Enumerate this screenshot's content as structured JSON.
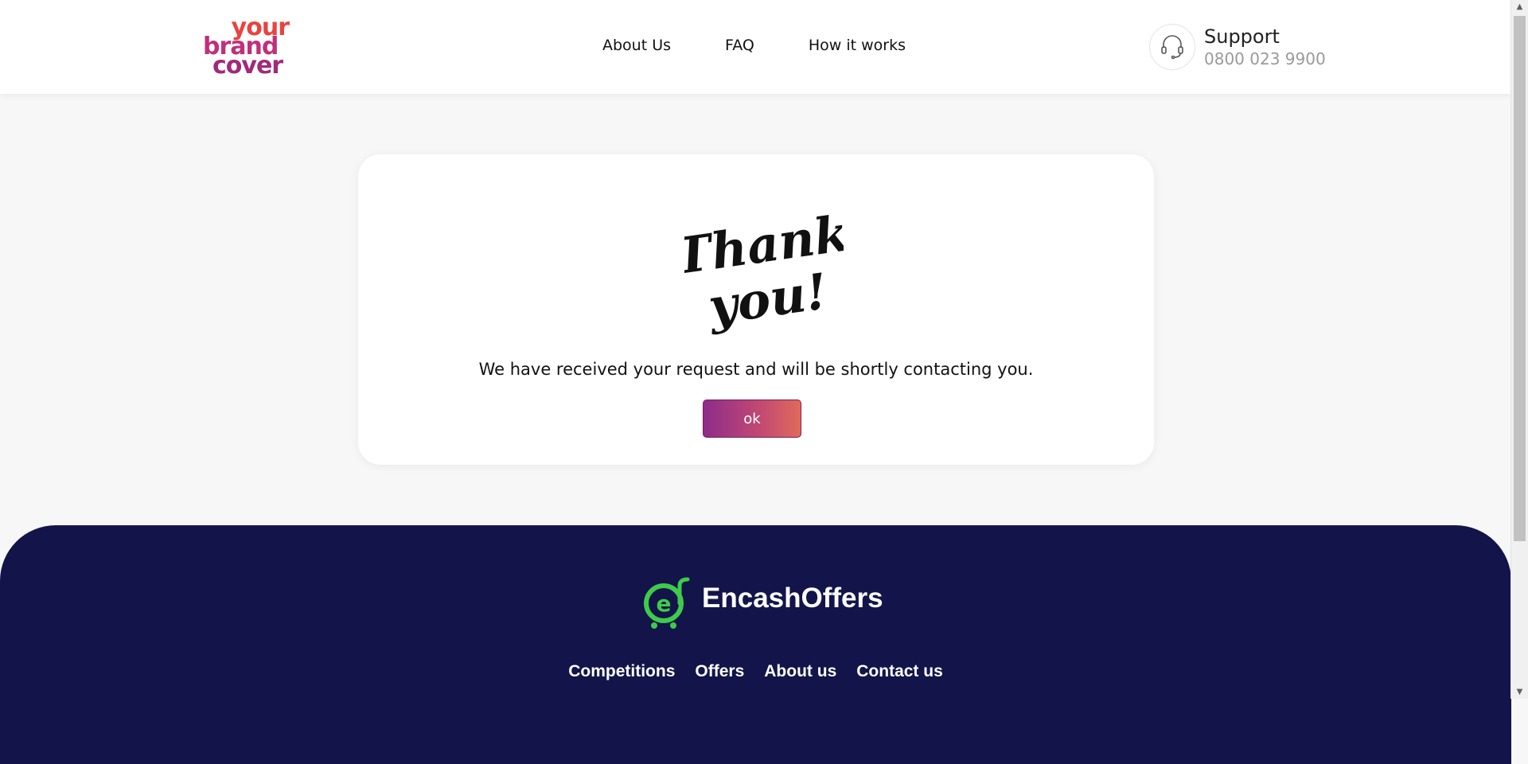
{
  "header": {
    "logo": {
      "line1": "your",
      "line2": "brand",
      "line3": "cover"
    },
    "nav": [
      {
        "label": "About Us"
      },
      {
        "label": "FAQ"
      },
      {
        "label": "How it works"
      }
    ],
    "support": {
      "icon": "headset-icon",
      "title": "Support",
      "phone": "0800 023 9900"
    }
  },
  "card": {
    "art": "Thank you!",
    "message": "We have received your request and will be shortly contacting you.",
    "ok_label": "ok"
  },
  "footer": {
    "brand_name": "EncashOffers",
    "links": [
      {
        "label": "Competitions"
      },
      {
        "label": "Offers"
      },
      {
        "label": "About us"
      },
      {
        "label": "Contact us"
      }
    ]
  },
  "colors": {
    "footer_bg": "#12144a",
    "brand_green": "#3ecb4a",
    "logo_red": "#e8443f",
    "logo_magenta": "#a02a7c",
    "button_gradient_start": "#8e2c8a",
    "button_gradient_end": "#e06a5a"
  }
}
